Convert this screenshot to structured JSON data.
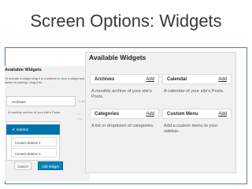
{
  "slide": {
    "title": "Screen Options: Widgets"
  },
  "left_panel": {
    "title": "Available Widgets",
    "description_start": "To activate a widget drag it to a sidebar or",
    "description_highlight": "click",
    "description_end": "a widget and delete its settings, drag it ba",
    "widget": "Archives",
    "widget_side": "Cale",
    "widget_description": "A monthly archive of your site's Posts.",
    "side_text": "Lo\nCa",
    "options": [
      {
        "label": "Sidebar",
        "selected": true
      },
      {
        "label": "Content Bottom 1",
        "selected": false
      },
      {
        "label": "Content Bottom 2",
        "selected": false
      }
    ],
    "cancel_label": "Cancel",
    "add_widget_label": "Add Widget"
  },
  "right_panel": {
    "title": "Available Widgets",
    "widgets": [
      {
        "name": "Archives",
        "add": "Add",
        "description": "A monthly archive of your site's Posts."
      },
      {
        "name": "Calendar",
        "add": "Add",
        "description": "A calendar of your site's Posts."
      },
      {
        "name": "Categories",
        "add": "Add",
        "description": "A list or dropdown of categories."
      },
      {
        "name": "Custom Menu",
        "add": "Add",
        "description": "Add a custom menu to your sidebar."
      }
    ]
  },
  "colors": {
    "accent": "#0073aa",
    "frame_border": "#5a7aa6",
    "panel_bg": "#f1f1f1"
  }
}
